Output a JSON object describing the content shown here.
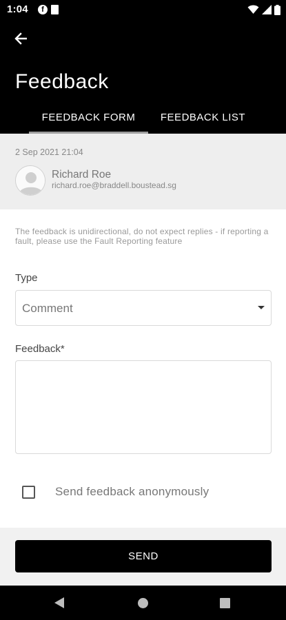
{
  "status_bar": {
    "time": "1:04",
    "icons": [
      "f-app-icon",
      "document-icon",
      "wifi-icon",
      "signal-icon",
      "battery-icon"
    ]
  },
  "header": {
    "title": "Feedback",
    "back_icon": "arrow-left-icon",
    "background_color": "#000000"
  },
  "tabs": [
    {
      "label": "FEEDBACK FORM",
      "active": true
    },
    {
      "label": "FEEDBACK LIST",
      "active": false
    }
  ],
  "user": {
    "date": "2 Sep 2021 21:04",
    "name": "Richard Roe",
    "email": "richard.roe@braddell.boustead.sg",
    "avatar_icon": "default-avatar-icon"
  },
  "form": {
    "notice": "The feedback is unidirectional, do not expect replies - if reporting a fault, please use the Fault Reporting feature",
    "type_label": "Type",
    "type_value": "Comment",
    "feedback_label": "Feedback*",
    "feedback_value": "",
    "anonymous_label": "Send feedback anonymously",
    "anonymous_checked": false
  },
  "actions": {
    "send_label": "SEND",
    "send_color": "#000000"
  },
  "nav_bar": {
    "icons": [
      "nav-back-icon",
      "nav-home-icon",
      "nav-recents-icon"
    ]
  }
}
